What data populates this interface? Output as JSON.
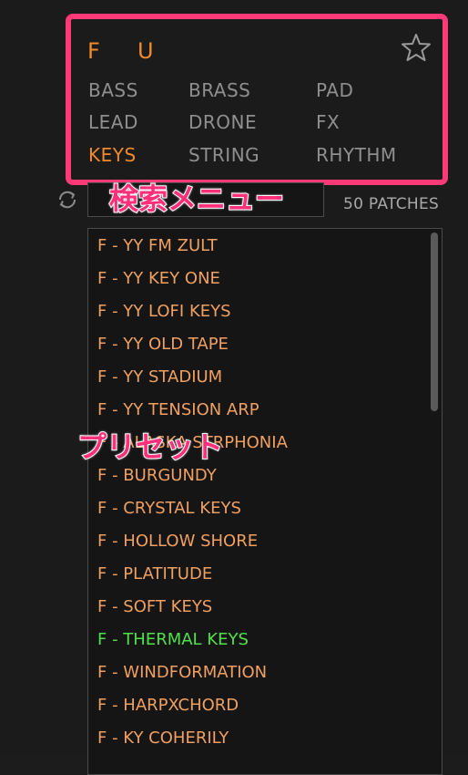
{
  "filter_menu": {
    "letters": [
      "F",
      "U"
    ],
    "categories": [
      {
        "label": "BASS",
        "active": false
      },
      {
        "label": "BRASS",
        "active": false
      },
      {
        "label": "PAD",
        "active": false
      },
      {
        "label": "LEAD",
        "active": false
      },
      {
        "label": "DRONE",
        "active": false
      },
      {
        "label": "FX",
        "active": false
      },
      {
        "label": "KEYS",
        "active": true
      },
      {
        "label": "STRING",
        "active": false
      },
      {
        "label": "RHYTHM",
        "active": false
      }
    ]
  },
  "search": {
    "value": "",
    "patch_count": "50 PATCHES"
  },
  "annotations": {
    "menu_label": "検索メニュー",
    "preset_label": "プリセット"
  },
  "presets": {
    "items": [
      "F - YY FM ZULT",
      "F - YY KEY ONE",
      "F - YY LOFI KEYS",
      "F - YY OLD TAPE",
      "F - YY STADIUM",
      "F - YY TENSION ARP",
      "F - ALASKA STRPHONIA",
      "F - BURGUNDY",
      "F - CRYSTAL KEYS",
      "F - HOLLOW SHORE",
      "F - PLATITUDE",
      "F - SOFT KEYS",
      "F - THERMAL KEYS",
      "F - WINDFORMATION",
      "F - HARPXCHORD",
      "F - KY COHERILY"
    ],
    "selected_index": 12
  },
  "colors": {
    "accent_orange": "#f08a2a",
    "preset_text": "#f0a060",
    "selected_green": "#4fe04a",
    "annotation_pink": "#ff2f7a"
  }
}
